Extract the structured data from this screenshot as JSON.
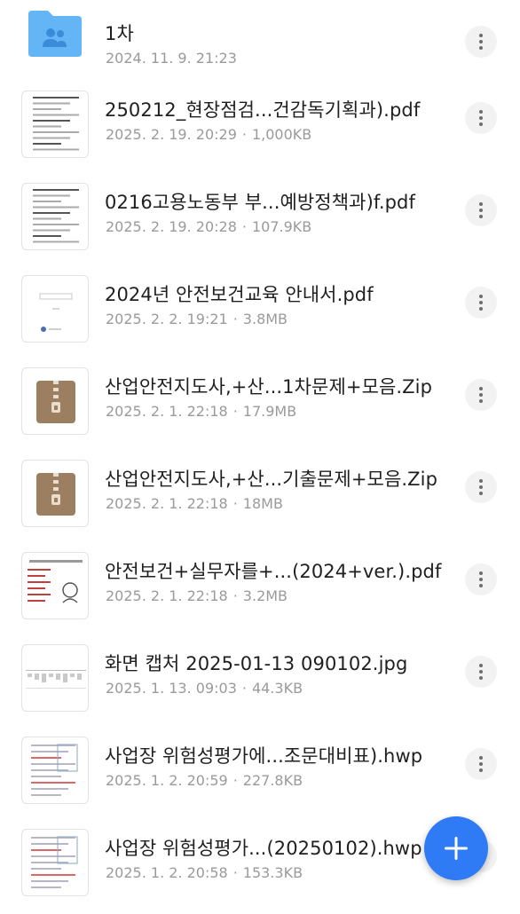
{
  "folder": {
    "name": "1차",
    "date": "2024. 11. 9. 21:23",
    "icon": "shared-folder-icon"
  },
  "files": [
    {
      "name": "250212_현장점검...건감독기획과).pdf",
      "date": "2025. 2. 19. 20:29",
      "size": "1,000KB",
      "thumb": "pdf"
    },
    {
      "name": "0216고용노동부 부...예방정책과)f.pdf",
      "date": "2025. 2. 19. 20:28",
      "size": "107.9KB",
      "thumb": "pdf"
    },
    {
      "name": "2024년 안전보건교육 안내서.pdf",
      "date": "2025. 2. 2. 19:21",
      "size": "3.8MB",
      "thumb": "pdf-cover"
    },
    {
      "name": "산업안전지도사,+산...1차문제+모음.Zip",
      "date": "2025. 2. 1. 22:18",
      "size": "17.9MB",
      "thumb": "zip"
    },
    {
      "name": "산업안전지도사,+산...기출문제+모음.Zip",
      "date": "2025. 2. 1. 22:18",
      "size": "18MB",
      "thumb": "zip"
    },
    {
      "name": "안전보건+실무자를+...(2024+ver.).pdf",
      "date": "2025. 2. 1. 22:18",
      "size": "3.2MB",
      "thumb": "pdf-poster"
    },
    {
      "name": "화면 캡처 2025-01-13 090102.jpg",
      "date": "2025. 1. 13. 09:03",
      "size": "44.3KB",
      "thumb": "image"
    },
    {
      "name": "사업장 위험성평가에...조문대비표).hwp",
      "date": "2025. 1. 2. 20:59",
      "size": "227.8KB",
      "thumb": "hwp"
    },
    {
      "name": "사업장 위험성평가...(20250102).hwp",
      "date": "2025. 1. 2. 20:58",
      "size": "153.3KB",
      "thumb": "hwp"
    }
  ],
  "separator": "·",
  "fab": {
    "icon": "plus-icon"
  },
  "colors": {
    "accent": "#2f7bf5",
    "folder": "#64b5f6",
    "zip": "#9c7e60",
    "meta_text": "#9a9a9a"
  }
}
